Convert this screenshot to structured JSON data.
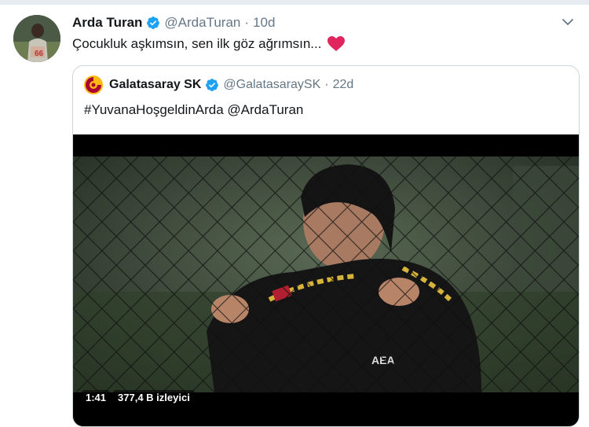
{
  "tweet": {
    "author_name": "Arda Turan",
    "handle": "@ArdaTuran",
    "separator": "·",
    "time": "10d",
    "text": "Çocukluk aşkımsın, sen ilk göz ağrımsın...",
    "emoji": "heart-emoji"
  },
  "quote": {
    "author_name": "Galatasaray SK",
    "handle": "@GalatasaraySK",
    "separator": "·",
    "time": "22d",
    "text": "#YuvanaHoşgeldinArda @ArdaTuran",
    "video": {
      "duration": "1:41",
      "views": "377,4 B izleyici"
    }
  },
  "colors": {
    "verified": "#1da1f2",
    "secondary_text": "#657786",
    "heart": "#e0245e",
    "border": "#ccd6dd"
  },
  "icons": [
    "verified-icon",
    "caret-down-icon",
    "heart-icon",
    "galatasaray-logo"
  ]
}
